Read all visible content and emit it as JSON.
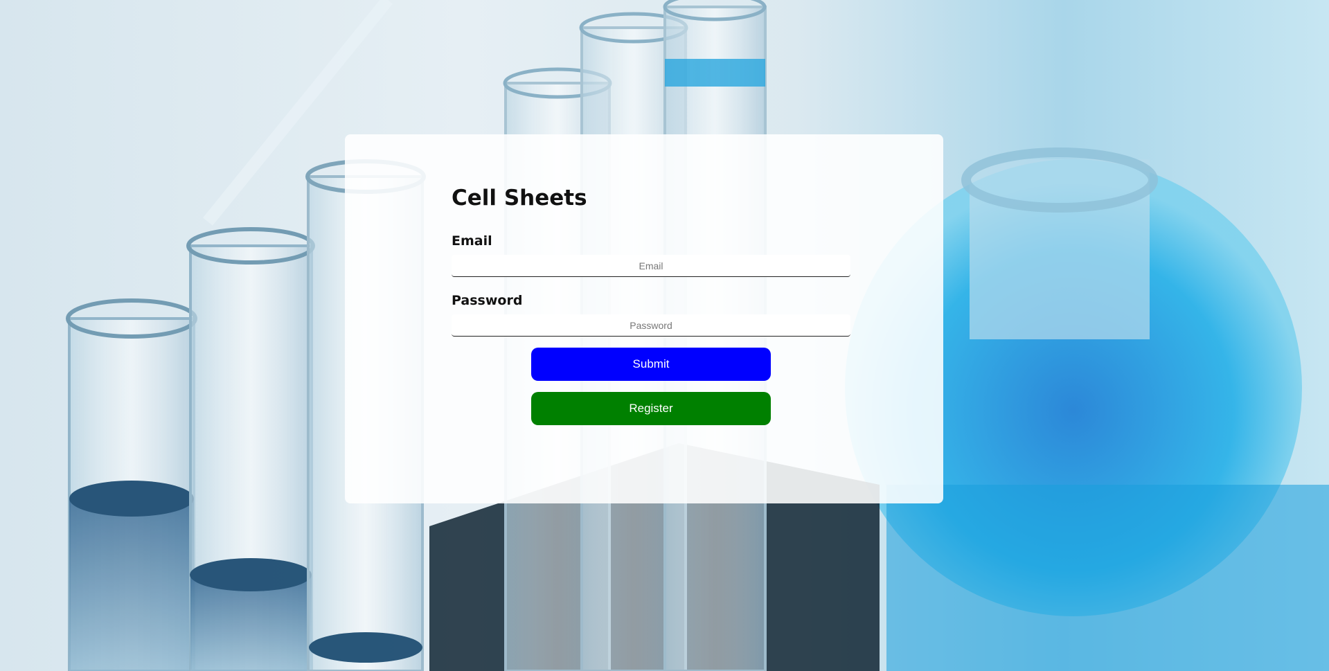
{
  "app": {
    "title": "Cell Sheets"
  },
  "form": {
    "email_label": "Email",
    "email_placeholder": "Email",
    "email_value": "",
    "password_label": "Password",
    "password_placeholder": "Password",
    "password_value": "",
    "submit_label": "Submit",
    "register_label": "Register"
  },
  "colors": {
    "submit_button": "#0000ff",
    "register_button": "#008000",
    "card": "#ffffff"
  },
  "background": {
    "icon": "laboratory-glassware-photo-icon"
  }
}
